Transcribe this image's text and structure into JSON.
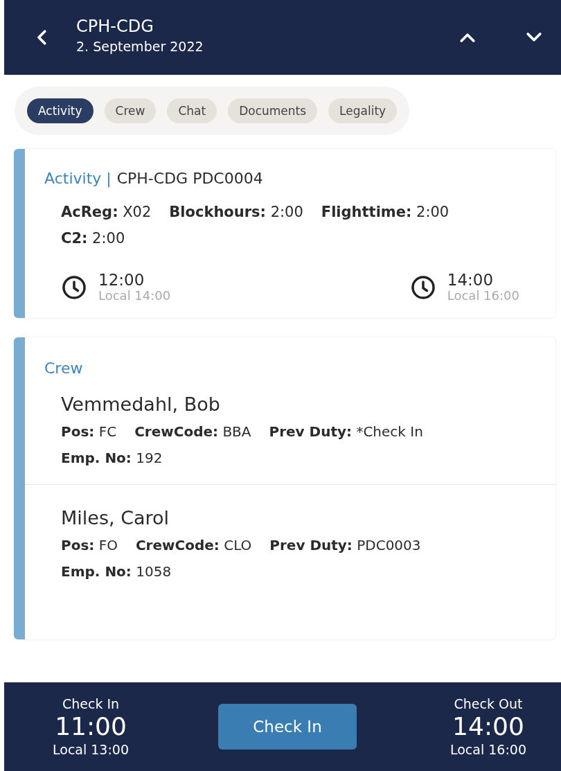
{
  "header": {
    "title": "CPH-CDG",
    "subtitle": "2. September 2022"
  },
  "tabs": [
    {
      "label": "Activity",
      "selected": true
    },
    {
      "label": "Crew",
      "selected": false
    },
    {
      "label": "Chat",
      "selected": false
    },
    {
      "label": "Documents",
      "selected": false
    },
    {
      "label": "Legality",
      "selected": false
    }
  ],
  "activity": {
    "section": "Activity |",
    "title": "CPH-CDG PDC0004",
    "fields": [
      "**AcReg:** X02",
      "**Blockhours:** 2:00",
      "**Flighttime:** 2:00",
      "**C2:** 2:00"
    ],
    "times": [
      {
        "time": "12:00",
        "local": "Local 14:00"
      },
      {
        "time": "14:00",
        "local": "Local 16:00"
      }
    ]
  },
  "crew": {
    "section": "Crew",
    "members": [
      {
        "name": "Vemmedahl, Bob",
        "fields": [
          "**Pos:** FC",
          "**CrewCode:** BBA",
          "**Prev Duty:** *Check In",
          "**Emp. No:** 192"
        ]
      },
      {
        "name": "Miles, Carol",
        "fields": [
          "**Pos:** FO",
          "**CrewCode:** CLO",
          "**Prev Duty:** PDC0003",
          "**Emp. No:** 1058"
        ]
      }
    ]
  },
  "footer": {
    "check_in": {
      "label": "Check In",
      "time": "11:00",
      "local": "Local 13:00"
    },
    "button": "Check In",
    "check_out": {
      "label": "Check Out",
      "time": "14:00",
      "local": "Local 16:00"
    }
  }
}
